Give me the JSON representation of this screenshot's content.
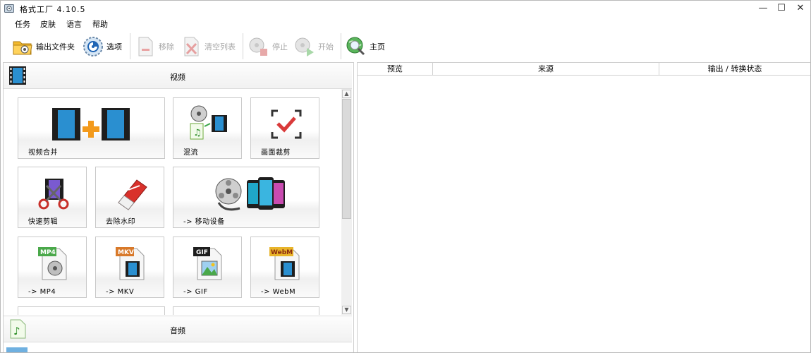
{
  "window": {
    "title": "格式工厂 4.10.5",
    "controls": {
      "minimize": "—",
      "maximize": "☐",
      "close": "✕"
    }
  },
  "menu": [
    {
      "label": "任务"
    },
    {
      "label": "皮肤"
    },
    {
      "label": "语言"
    },
    {
      "label": "帮助"
    }
  ],
  "toolbar": {
    "output_folder": "输出文件夹",
    "options": "选项",
    "remove": "移除",
    "clear_list": "清空列表",
    "stop": "停止",
    "start": "开始",
    "home": "主页"
  },
  "categories": {
    "video": "视频",
    "audio": "音频"
  },
  "video_tiles": {
    "merge": "视频合并",
    "mix": "混流",
    "crop": "画面裁剪",
    "quick_cut": "快速剪辑",
    "watermark": "去除水印",
    "mobile": "-> 移动设备",
    "mp4": "-> MP4",
    "mkv": "-> MKV",
    "gif": "-> GIF",
    "webm": "-> WebM"
  },
  "icon_texts": {
    "mp4_badge": "MP4",
    "mkv_badge": "MKV",
    "gif_badge": "GIF",
    "webm_badge": "WebM"
  },
  "task_list": {
    "columns": [
      "预览",
      "来源",
      "输出 / 转换状态"
    ]
  },
  "colors": {
    "accent_orange": "#f39a1c",
    "film_blue": "#2a8fd0",
    "check_red": "#d93a3a",
    "globe_green": "#3aa648"
  }
}
